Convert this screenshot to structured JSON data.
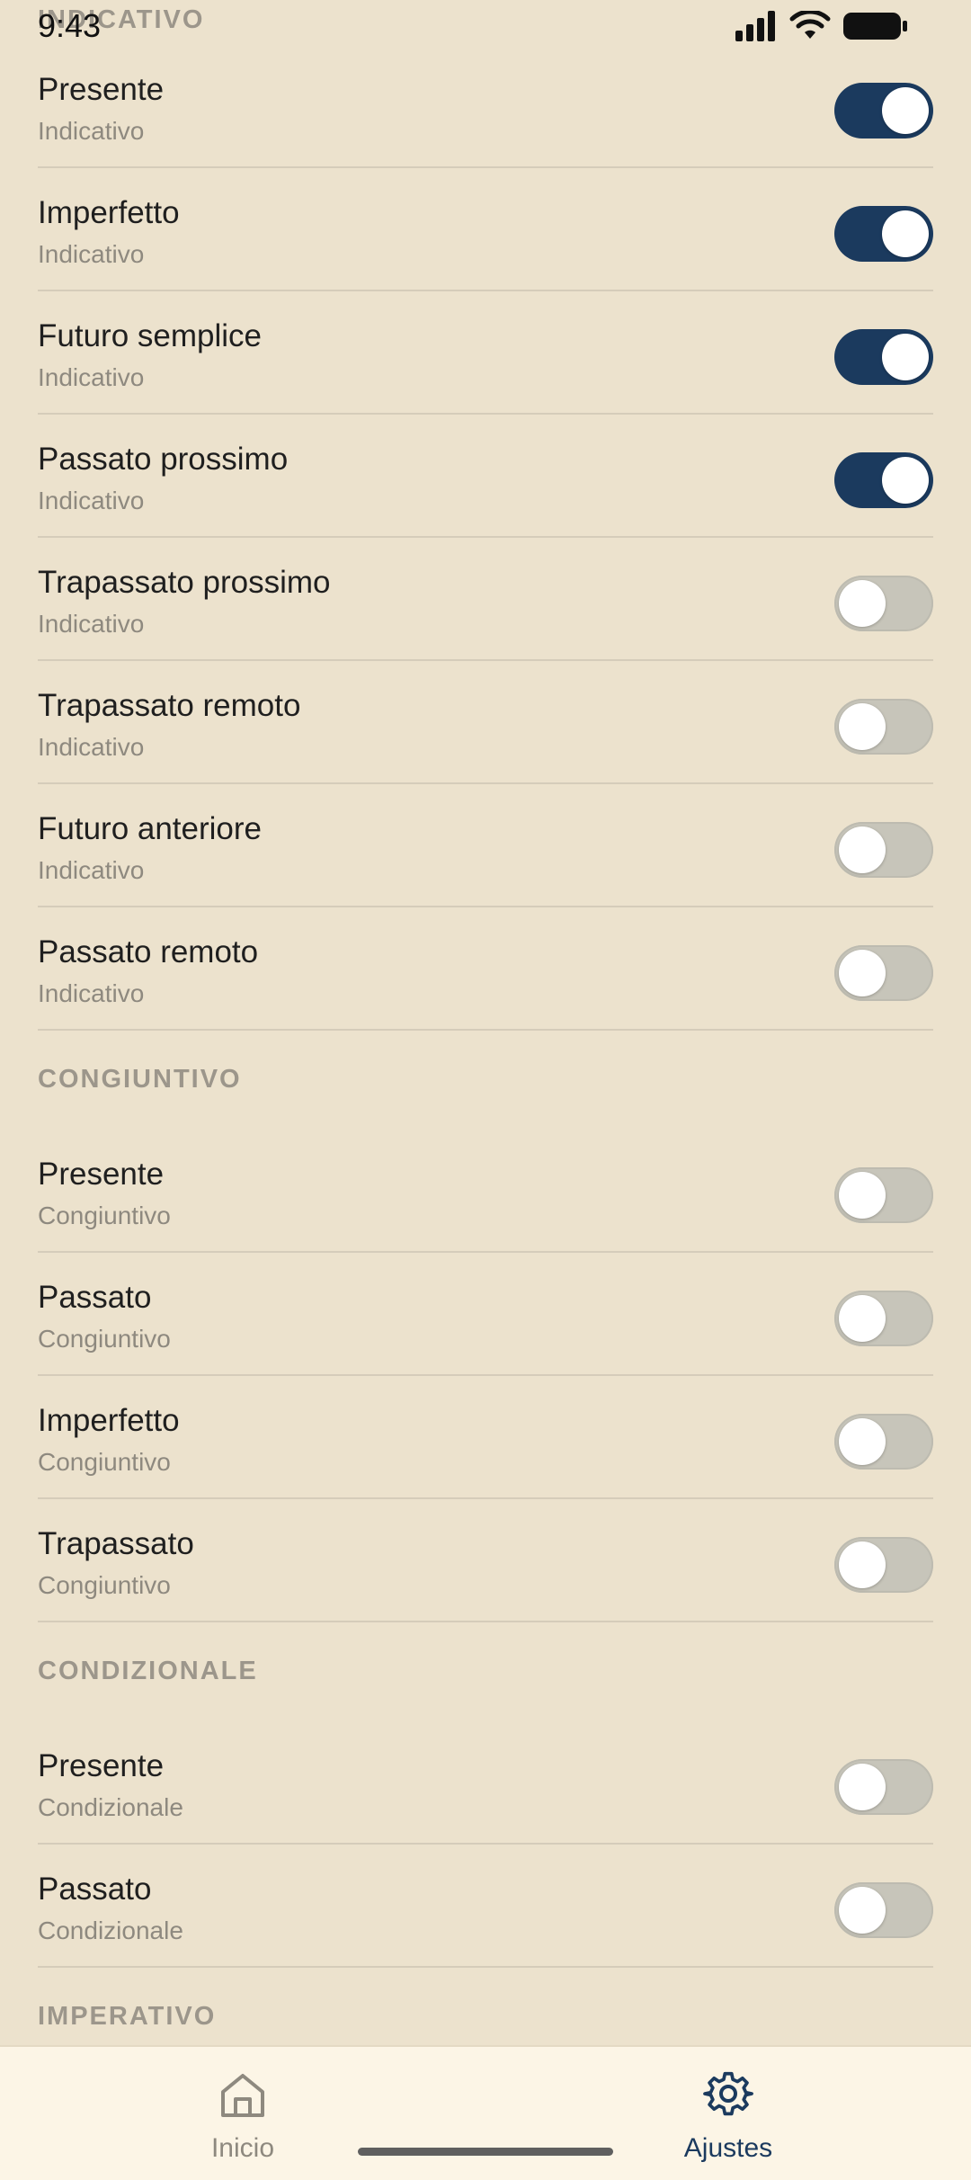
{
  "status_bar": {
    "time": "9:43"
  },
  "partial_section_header": "INDICATIVO",
  "sections": [
    {
      "header": null,
      "rows": [
        {
          "title": "Presente",
          "subtitle": "Indicativo",
          "enabled": true
        },
        {
          "title": "Imperfetto",
          "subtitle": "Indicativo",
          "enabled": true
        },
        {
          "title": "Futuro semplice",
          "subtitle": "Indicativo",
          "enabled": true
        },
        {
          "title": "Passato prossimo",
          "subtitle": "Indicativo",
          "enabled": true
        },
        {
          "title": "Trapassato prossimo",
          "subtitle": "Indicativo",
          "enabled": false
        },
        {
          "title": "Trapassato remoto",
          "subtitle": "Indicativo",
          "enabled": false
        },
        {
          "title": "Futuro anteriore",
          "subtitle": "Indicativo",
          "enabled": false
        },
        {
          "title": "Passato remoto",
          "subtitle": "Indicativo",
          "enabled": false
        }
      ]
    },
    {
      "header": "CONGIUNTIVO",
      "rows": [
        {
          "title": "Presente",
          "subtitle": "Congiuntivo",
          "enabled": false
        },
        {
          "title": "Passato",
          "subtitle": "Congiuntivo",
          "enabled": false
        },
        {
          "title": "Imperfetto",
          "subtitle": "Congiuntivo",
          "enabled": false
        },
        {
          "title": "Trapassato",
          "subtitle": "Congiuntivo",
          "enabled": false
        }
      ]
    },
    {
      "header": "CONDIZIONALE",
      "rows": [
        {
          "title": "Presente",
          "subtitle": "Condizionale",
          "enabled": false
        },
        {
          "title": "Passato",
          "subtitle": "Condizionale",
          "enabled": false
        }
      ]
    },
    {
      "header": "IMPERATIVO",
      "rows": []
    }
  ],
  "bottom_nav": {
    "home": {
      "label": "Inicio",
      "icon": "home-icon",
      "active": false
    },
    "settings": {
      "label": "Ajustes",
      "icon": "gear-icon",
      "active": true
    }
  },
  "colors": {
    "background": "#ECE2CD",
    "toggle_on": "#1B3A5E",
    "toggle_off": "#C7C5BA",
    "nav_background": "#FCF5E6",
    "accent": "#1B3A5E"
  }
}
